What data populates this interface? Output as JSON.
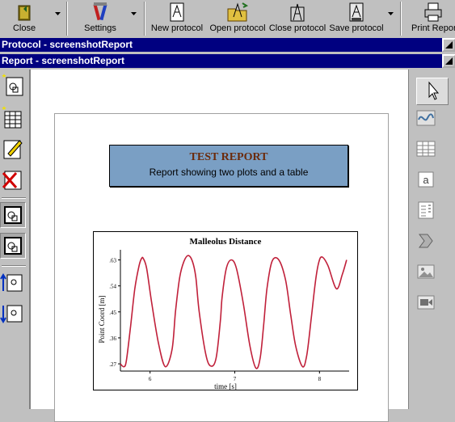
{
  "toolbar": {
    "close_label": "Close",
    "settings_label": "Settings",
    "new_protocol_label": "New protocol",
    "open_protocol_label": "Open protocol",
    "close_protocol_label": "Close protocol",
    "save_protocol_label": "Save protocol",
    "print_report_label": "Print Report"
  },
  "windows": {
    "protocol_title": "Protocol - screenshotReport",
    "report_title": "Report - screenshotReport"
  },
  "report": {
    "title": "TEST REPORT",
    "subtitle": "Report showing two plots and a table"
  },
  "left_palette": [
    "add-plot-icon",
    "add-table-icon",
    "edit-icon",
    "delete-icon",
    "plot-selected-icon",
    "plot-selected-2-icon",
    "move-up-icon",
    "move-down-icon"
  ],
  "right_palette": [
    "pointer-icon",
    "curve-icon",
    "table-icon",
    "text-icon",
    "list-icon",
    "arrow-icon",
    "image-icon",
    "video-icon"
  ],
  "chart_data": {
    "type": "line",
    "title": "Malleolus Distance",
    "xlabel": "time [s]",
    "ylabel": "Point Coord [m]",
    "x_ticks": [
      "6",
      "7",
      "8"
    ],
    "y_ticks": [
      ".27",
      ".36",
      ".45",
      ".54",
      ".63"
    ],
    "xlim": [
      5.65,
      8.35
    ],
    "ylim": [
      0.245,
      0.665
    ],
    "line_color": "#c0203a",
    "series": [
      {
        "x": [
          5.65,
          5.69,
          5.72,
          5.77,
          5.82,
          5.87,
          5.9,
          5.92,
          5.96,
          6.02,
          6.1,
          6.18,
          6.26,
          6.3,
          6.35,
          6.4,
          6.45,
          6.5,
          6.54,
          6.58,
          6.66,
          6.72,
          6.78,
          6.83,
          6.85,
          6.9,
          6.96,
          7.02,
          7.1,
          7.18,
          7.25,
          7.3,
          7.34,
          7.38,
          7.44,
          7.52,
          7.6,
          7.66,
          7.72,
          7.8,
          7.85,
          7.9,
          7.95,
          7.99,
          8.03,
          8.1,
          8.2,
          8.27,
          8.32
        ],
        "y": [
          0.27,
          0.26,
          0.28,
          0.4,
          0.53,
          0.61,
          0.635,
          0.635,
          0.6,
          0.48,
          0.34,
          0.26,
          0.32,
          0.45,
          0.57,
          0.625,
          0.645,
          0.625,
          0.57,
          0.45,
          0.3,
          0.262,
          0.29,
          0.42,
          0.5,
          0.6,
          0.63,
          0.6,
          0.48,
          0.33,
          0.255,
          0.29,
          0.4,
          0.53,
          0.625,
          0.63,
          0.56,
          0.44,
          0.33,
          0.26,
          0.3,
          0.42,
          0.55,
          0.62,
          0.64,
          0.61,
          0.53,
          0.58,
          0.63
        ]
      }
    ]
  }
}
